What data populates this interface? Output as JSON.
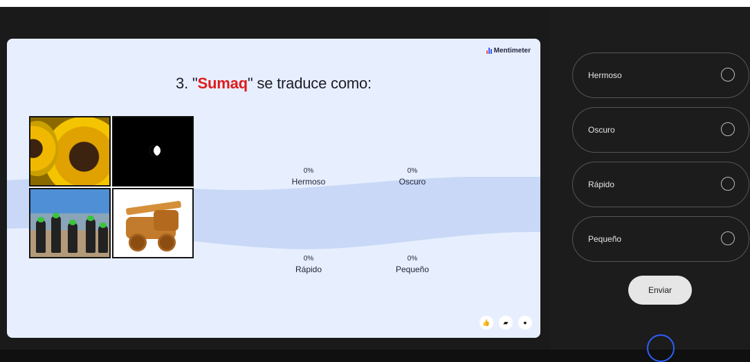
{
  "brand": "Mentimeter",
  "question": {
    "prefix": "3. \"",
    "keyword": "Sumaq",
    "suffix": "\" se traduce como:"
  },
  "results": [
    {
      "percent": "0%",
      "label": "Hermoso"
    },
    {
      "percent": "0%",
      "label": "Oscuro"
    },
    {
      "percent": "0%",
      "label": "Rápido"
    },
    {
      "percent": "0%",
      "label": "Pequeño"
    }
  ],
  "choices": [
    "Hermoso",
    "Oscuro",
    "Rápido",
    "Pequeño"
  ],
  "submit_label": "Enviar",
  "icons": {
    "reactions": [
      "thumbs-up-icon",
      "comment-icon",
      "user-icon"
    ]
  },
  "colors": {
    "keyword": "#e01b1b",
    "slide_bg": "#e7efff",
    "wave": "#c8d8f6",
    "accent": "#2d5fff"
  }
}
